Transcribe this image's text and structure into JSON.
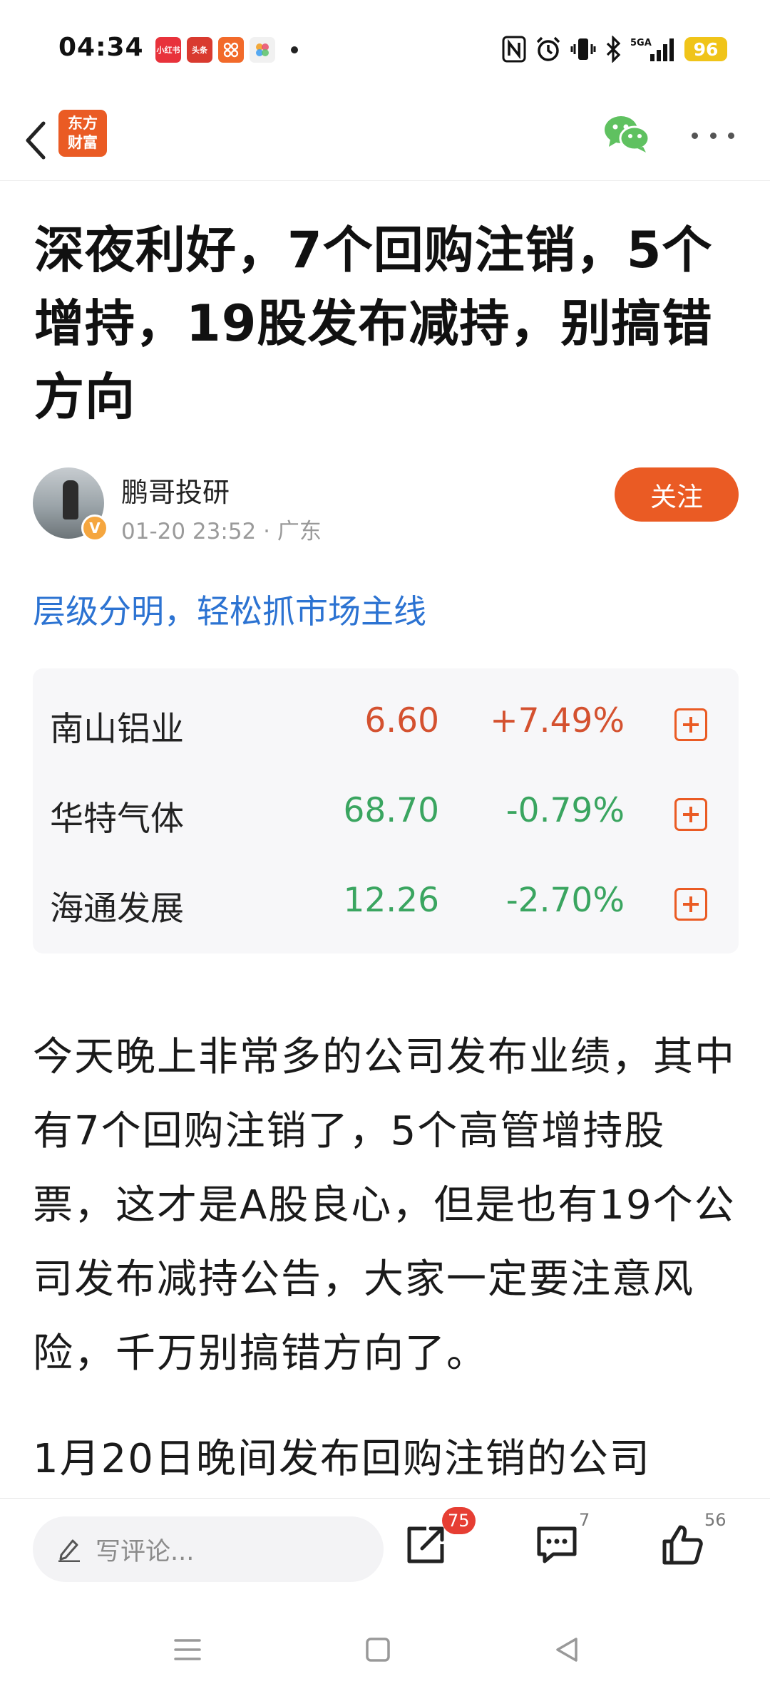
{
  "status_bar": {
    "time": "04:34",
    "notification_icons": [
      "xiaohongshu-icon",
      "toutiao-icon",
      "app-icon",
      "photos-icon"
    ],
    "notification_labels": [
      "小红书",
      "头条"
    ],
    "battery": "96"
  },
  "nav": {
    "logo_line1": "东方",
    "logo_line2": "财富"
  },
  "article": {
    "title": "深夜利好，7个回购注销，5个增持，19股发布减持，别搞错方向",
    "author": "鹏哥投研",
    "badge": "V",
    "datetime": "01-20 23:52",
    "location": "· 广东",
    "follow_label": "关注",
    "tagline": "层级分明，轻松抓市场主线",
    "paragraph1": "今天晚上非常多的公司发布业绩，其中有7个回购注销了，5个高管增持股票，这才是A股良心，但是也有19个公司发布减持公告，大家一定要注意风险，千万别搞错方向了。",
    "paragraph2": "1月20日晚间发布回购注销的公司"
  },
  "stocks": [
    {
      "name": "南山铝业",
      "price": "6.60",
      "change": "+7.49%",
      "direction": "up"
    },
    {
      "name": "华特气体",
      "price": "68.70",
      "change": "-0.79%",
      "direction": "down"
    },
    {
      "name": "海通发展",
      "price": "12.26",
      "change": "-2.70%",
      "direction": "down"
    }
  ],
  "bottom_bar": {
    "comment_placeholder": "写评论...",
    "share_count": "75",
    "comment_count": "7",
    "like_count": "56"
  },
  "colors": {
    "brand": "#ea5b24",
    "up": "#d4512f",
    "down": "#3aa560",
    "link": "#2c73d2"
  }
}
